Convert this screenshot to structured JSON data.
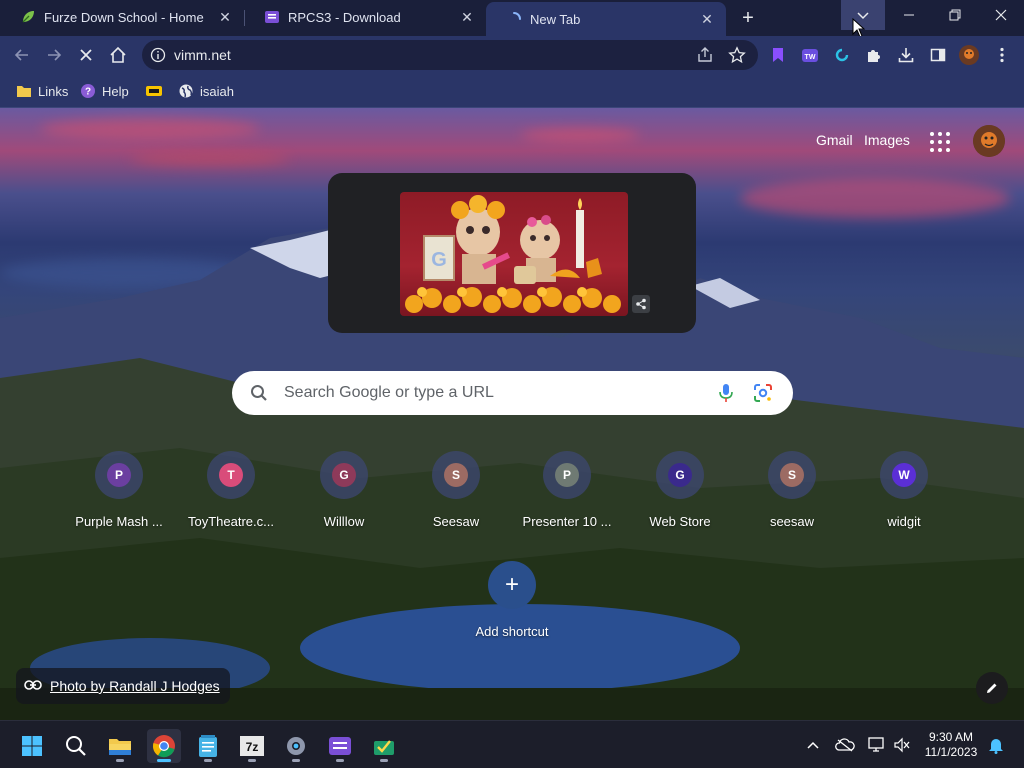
{
  "tabs": [
    {
      "title": "Furze Down School - Home",
      "icon": "leaf-favicon-icon"
    },
    {
      "title": "RPCS3 - Download",
      "icon": "rpcs3-favicon-icon"
    },
    {
      "title": "New Tab",
      "icon": "loading-spinner-icon",
      "active": true
    }
  ],
  "toolbar": {
    "url": "vimm.net"
  },
  "bookmarks": [
    {
      "label": "Links",
      "icon": "folder-icon"
    },
    {
      "label": "Help",
      "icon": "help-icon"
    },
    {
      "label": "",
      "icon": "yellow-bookmark-icon"
    },
    {
      "label": "isaiah",
      "icon": "globe-icon"
    }
  ],
  "ntp": {
    "gmail": "Gmail",
    "images": "Images",
    "search_placeholder": "Search Google or type a URL",
    "shortcuts": [
      {
        "label": "Purple Mash ...",
        "letter": "P",
        "color": "#6b3fa0"
      },
      {
        "label": "ToyTheatre.c...",
        "letter": "T",
        "color": "#d94c7a"
      },
      {
        "label": "Willlow",
        "letter": "G",
        "color": "#8e3a5a"
      },
      {
        "label": "Seesaw",
        "letter": "S",
        "color": "#9c6b63"
      },
      {
        "label": "Presenter 10 ...",
        "letter": "P",
        "color": "#6f7a73"
      },
      {
        "label": "Web Store",
        "letter": "G",
        "color": "#3a2a8c"
      },
      {
        "label": "seesaw",
        "letter": "S",
        "color": "#9c6b63"
      },
      {
        "label": "widgit",
        "letter": "W",
        "color": "#5b2fd6"
      }
    ],
    "add_shortcut": "Add shortcut",
    "attribution": "Photo by Randall J Hodges"
  },
  "taskbar": {
    "time": "9:30 AM",
    "date": "11/1/2023"
  },
  "colors": {
    "tabstrip": "#1a1f3a",
    "toolbar": "#2a3567",
    "accent": "#4cc2ff"
  }
}
